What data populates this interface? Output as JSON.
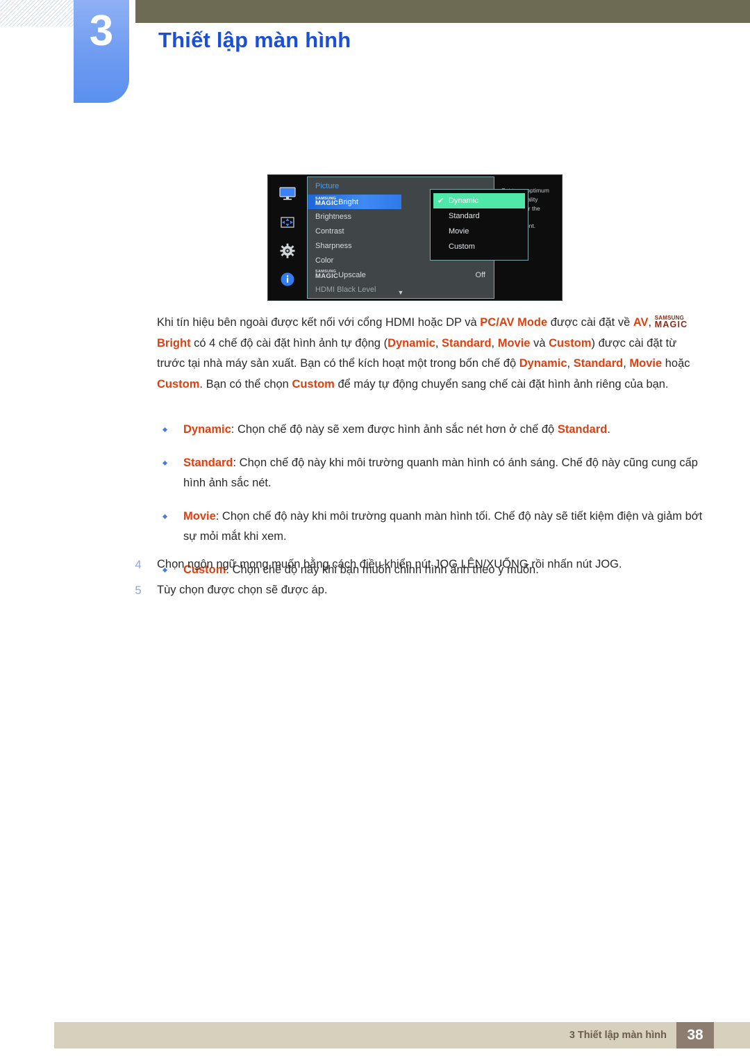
{
  "header": {
    "chapter_number": "3",
    "chapter_title": "Thiết lập màn hình"
  },
  "osd": {
    "panel_title": "Picture",
    "icons": [
      {
        "name": "monitor-icon"
      },
      {
        "name": "position-arrows-icon"
      },
      {
        "name": "gear-icon"
      },
      {
        "name": "info-icon"
      }
    ],
    "menu_items": [
      {
        "logo_top": "SAMSUNG",
        "logo_bottom": "MAGIC",
        "label": "Bright",
        "value": "",
        "selected": true
      },
      {
        "label": "Brightness",
        "value": ""
      },
      {
        "label": "Contrast",
        "value": ""
      },
      {
        "label": "Sharpness",
        "value": ""
      },
      {
        "label": "Color",
        "value": ""
      },
      {
        "logo_top": "SAMSUNG",
        "logo_bottom": "MAGIC",
        "label": "Upscale",
        "value": "Off"
      },
      {
        "label": "HDMI Black Level",
        "value": "",
        "dim": true
      }
    ],
    "scroll_arrow": "▼",
    "submenu": [
      {
        "label": "Dynamic",
        "checked": true,
        "check_glyph": "✔"
      },
      {
        "label": "Standard",
        "checked": false
      },
      {
        "label": "Movie",
        "checked": false
      },
      {
        "label": "Custom",
        "checked": false
      }
    ],
    "tooltip": "Set to an optimum picture quality suitable for the working environment."
  },
  "body": {
    "paragraph_part1": "Khi tín hiệu bên ngoài được kết nối với cổng HDMI hoặc DP và ",
    "kw_pcav": "PC/AV Mode",
    "paragraph_part2": " được cài đặt về ",
    "kw_av": "AV",
    "paragraph_part3": ", ",
    "magic_top": "SAMSUNG",
    "magic_bottom": "MAGIC",
    "kw_bright": "Bright",
    "paragraph_part4": " có 4 chế độ cài đặt hình ảnh tự động (",
    "kw_dynamic": "Dynamic",
    "sep1": ", ",
    "kw_standard": "Standard",
    "sep2": ", ",
    "kw_movie": "Movie",
    "paragraph_part5": " và ",
    "kw_custom": "Custom",
    "paragraph_part6": ") được cài đặt từ trước tại nhà máy sản xuất. Bạn có thể kích hoạt một trong bốn chế độ ",
    "kw_dynamic2": "Dynamic",
    "sep3": ", ",
    "kw_standard2": "Standard",
    "sep4": ", ",
    "kw_movie2": "Movie",
    "paragraph_part7": " hoặc ",
    "kw_custom2": "Custom",
    "paragraph_part8": ". Bạn có thể chọn ",
    "kw_custom3": "Custom",
    "paragraph_part9": " để máy tự động chuyển sang chế cài đặt hình ảnh riêng của bạn."
  },
  "bullets": [
    {
      "term": "Dynamic",
      "text_before": ": Chọn chế độ này sẽ xem được hình ảnh sắc nét hơn ở chế độ ",
      "term2": "Standard",
      "text_after": "."
    },
    {
      "term": "Standard",
      "text_before": ": Chọn chế độ này khi môi trường quanh màn hình có ánh sáng. Chế độ này cũng cung cấp hình ảnh sắc nét.",
      "term2": "",
      "text_after": ""
    },
    {
      "term": "Movie",
      "text_before": ": Chọn chế độ này khi môi trường quanh màn hình tối. Chế độ này sẽ tiết kiệm điện và giảm bớt sự mỏi mắt khi xem.",
      "term2": "",
      "text_after": ""
    },
    {
      "term": "Custom",
      "text_before": ": Chọn chế độ này khi bạn muốn chỉnh hình ảnh theo ý muốn.",
      "term2": "",
      "text_after": ""
    }
  ],
  "steps": [
    {
      "number": "4",
      "text": "Chọn ngôn ngữ mong muốn bằng cách điều khiển nút JOG LÊN/XUỐNG rồi nhấn nút JOG."
    },
    {
      "number": "5",
      "text": "Tùy chọn được chọn sẽ được áp."
    }
  ],
  "footer": {
    "text": "3 Thiết lập màn hình",
    "page_number": "38"
  },
  "colors": {
    "accent_blue": "#1a4fd6",
    "keyword_orange": "#e0400f",
    "osd_highlight_green": "#4fe8a8",
    "osd_selected_blue": "#2f78e8",
    "footer_bar": "#d6d0bc",
    "footer_box": "#8c7d70",
    "olive_bar": "#6e6b55"
  }
}
